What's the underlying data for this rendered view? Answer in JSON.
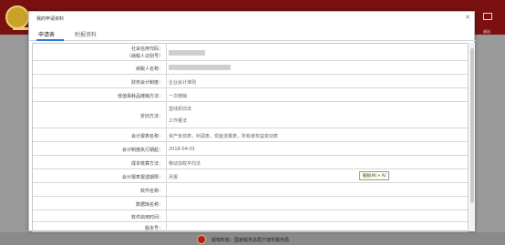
{
  "dialog": {
    "title": "我的申请资料",
    "tabs": [
      {
        "label": "申请表"
      },
      {
        "label": "附报资料"
      }
    ]
  },
  "form": {
    "rows": [
      {
        "label1": "社会信用代码：",
        "label2": "（纳税人识别号）"
      },
      {
        "label1": "纳税人名称："
      },
      {
        "label1": "财务会计制度：",
        "value1": "企业会计准则"
      },
      {
        "label1": "低值易耗品摊销方法：",
        "value1": "一次摊销"
      },
      {
        "label1": "折旧方法：",
        "value1": "直线折旧法",
        "value2": "工作量法"
      },
      {
        "label1": "会计报表名称：",
        "value1": "资产负债表，利润表，现金流量表，所有者权益变动表"
      },
      {
        "label1": "会计制度执行期起：",
        "value1": "2018-04-01"
      },
      {
        "label1": "成本核算方法：",
        "value1": "移动加权平均法"
      },
      {
        "label1": "会计报表报送期限：",
        "value1": "月报"
      },
      {
        "label1": "软件名称："
      },
      {
        "label1": "数据库名称："
      },
      {
        "label1": "软件启用时间："
      },
      {
        "label1": "版本号："
      }
    ]
  },
  "tooltip": {
    "text": "截图(Alt + A)"
  },
  "background": {
    "right_label": "退出",
    "footer_text": "版权所有：国家税务总局宁波市税务局"
  }
}
